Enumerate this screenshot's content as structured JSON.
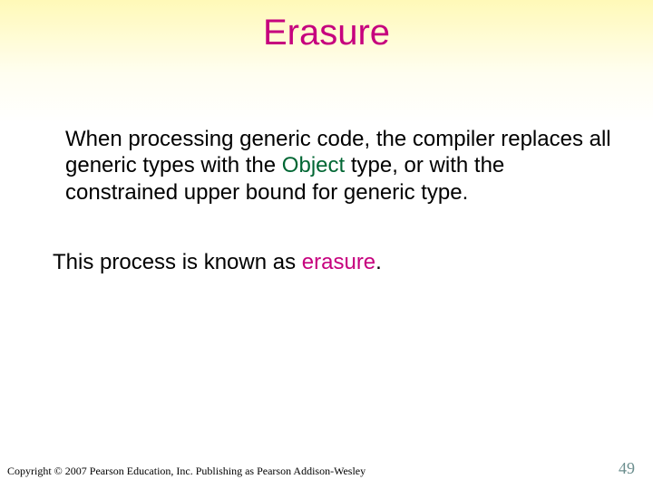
{
  "title": "Erasure",
  "p1_a": "When processing generic code, the compiler replaces all generic types with the ",
  "p1_obj": "Object",
  "p1_b": " type, or with the constrained upper bound for generic type.",
  "p2_a": "This process is known as ",
  "p2_er": "erasure",
  "p2_b": ".",
  "copyright": "Copyright © 2007 Pearson Education, Inc. Publishing as Pearson Addison-Wesley",
  "page": "49"
}
